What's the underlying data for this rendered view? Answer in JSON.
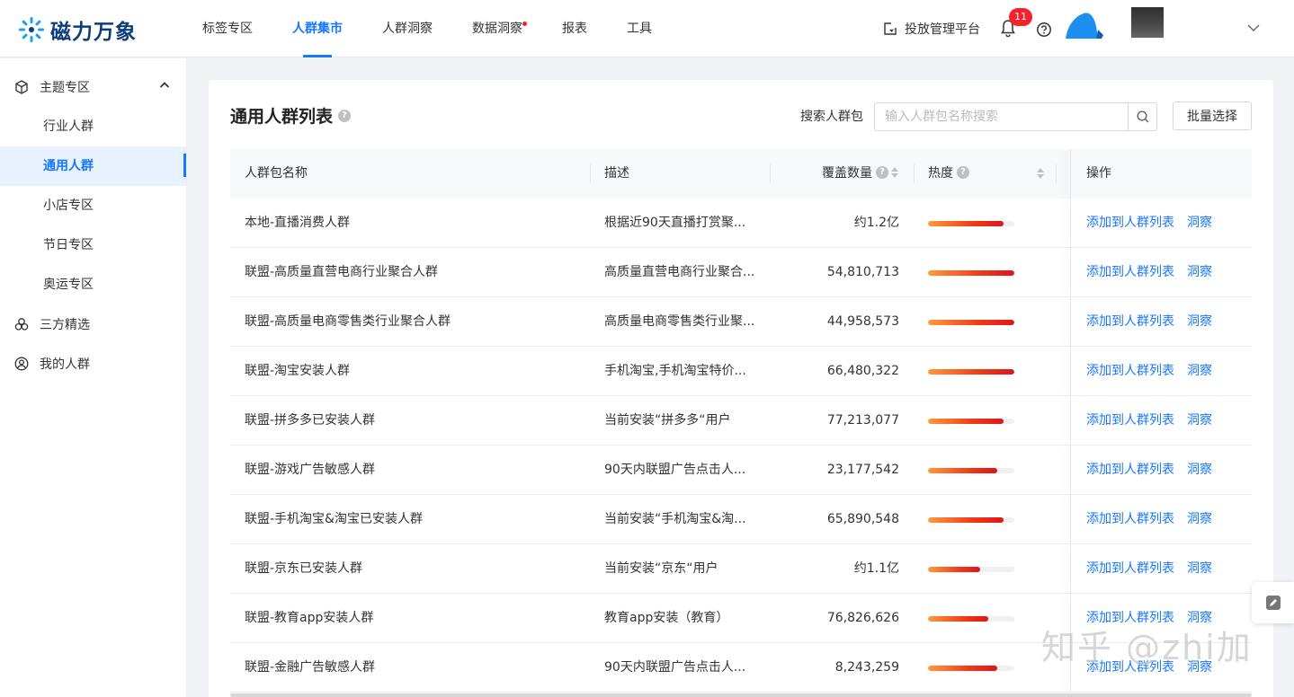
{
  "app": {
    "logo_text": "磁力万象"
  },
  "nav": {
    "items": [
      {
        "label": "标签专区",
        "active": false,
        "dot": false
      },
      {
        "label": "人群集市",
        "active": true,
        "dot": false
      },
      {
        "label": "人群洞察",
        "active": false,
        "dot": false
      },
      {
        "label": "数据洞察",
        "active": false,
        "dot": true
      },
      {
        "label": "报表",
        "active": false,
        "dot": false
      },
      {
        "label": "工具",
        "active": false,
        "dot": false
      }
    ],
    "platform_label": "投放管理平台",
    "notification_count": "11"
  },
  "sidebar": {
    "group1": "主题专区",
    "items": [
      {
        "label": "行业人群"
      },
      {
        "label": "通用人群"
      },
      {
        "label": "小店专区"
      },
      {
        "label": "节日专区"
      },
      {
        "label": "奥运专区"
      }
    ],
    "group2": "三方精选",
    "group3": "我的人群"
  },
  "main": {
    "title": "通用人群列表",
    "search_label": "搜索人群包",
    "search_placeholder": "输入人群包名称搜索",
    "batch_label": "批量选择",
    "columns": {
      "name": "人群包名称",
      "desc": "描述",
      "count": "覆盖数量",
      "heat": "热度",
      "ops": "操作"
    },
    "rows": [
      {
        "name": "本地-直播消费人群",
        "desc": "根据近90天直播打赏聚...",
        "count": "约1.2亿",
        "heat": 0.88
      },
      {
        "name": "联盟-高质量直营电商行业聚合人群",
        "desc": "高质量直营电商行业聚合...",
        "count": "54,810,713",
        "heat": 1.0
      },
      {
        "name": "联盟-高质量电商零售类行业聚合人群",
        "desc": "高质量电商零售类行业聚...",
        "count": "44,958,573",
        "heat": 1.0
      },
      {
        "name": "联盟-淘宝安装人群",
        "desc": "手机淘宝,手机淘宝特价...",
        "count": "66,480,322",
        "heat": 1.0
      },
      {
        "name": "联盟-拼多多已安装人群",
        "desc": "当前安装“拼多多“用户",
        "count": "77,213,077",
        "heat": 0.88
      },
      {
        "name": "联盟-游戏广告敏感人群",
        "desc": "90天内联盟广告点击人...",
        "count": "23,177,542",
        "heat": 0.8
      },
      {
        "name": "联盟-手机淘宝&淘宝已安装人群",
        "desc": "当前安装“手机淘宝&淘...",
        "count": "65,890,548",
        "heat": 0.88
      },
      {
        "name": "联盟-京东已安装人群",
        "desc": "当前安装“京东“用户",
        "count": "约1.1亿",
        "heat": 0.6
      },
      {
        "name": "联盟-教育app安装人群",
        "desc": "教育app安装（教育）",
        "count": "76,826,626",
        "heat": 0.7
      },
      {
        "name": "联盟-金融广告敏感人群",
        "desc": "90天内联盟广告点击人...",
        "count": "8,243,259",
        "heat": 0.8
      }
    ],
    "op_add_label": "添加到人群列表",
    "op_insight_label": "洞察"
  },
  "watermark": "知乎 @zhi加",
  "colors": {
    "accent": "#1677ff",
    "heat_start": "#ff9a3c",
    "heat_end": "#e0141a",
    "badge": "#f5222d"
  }
}
